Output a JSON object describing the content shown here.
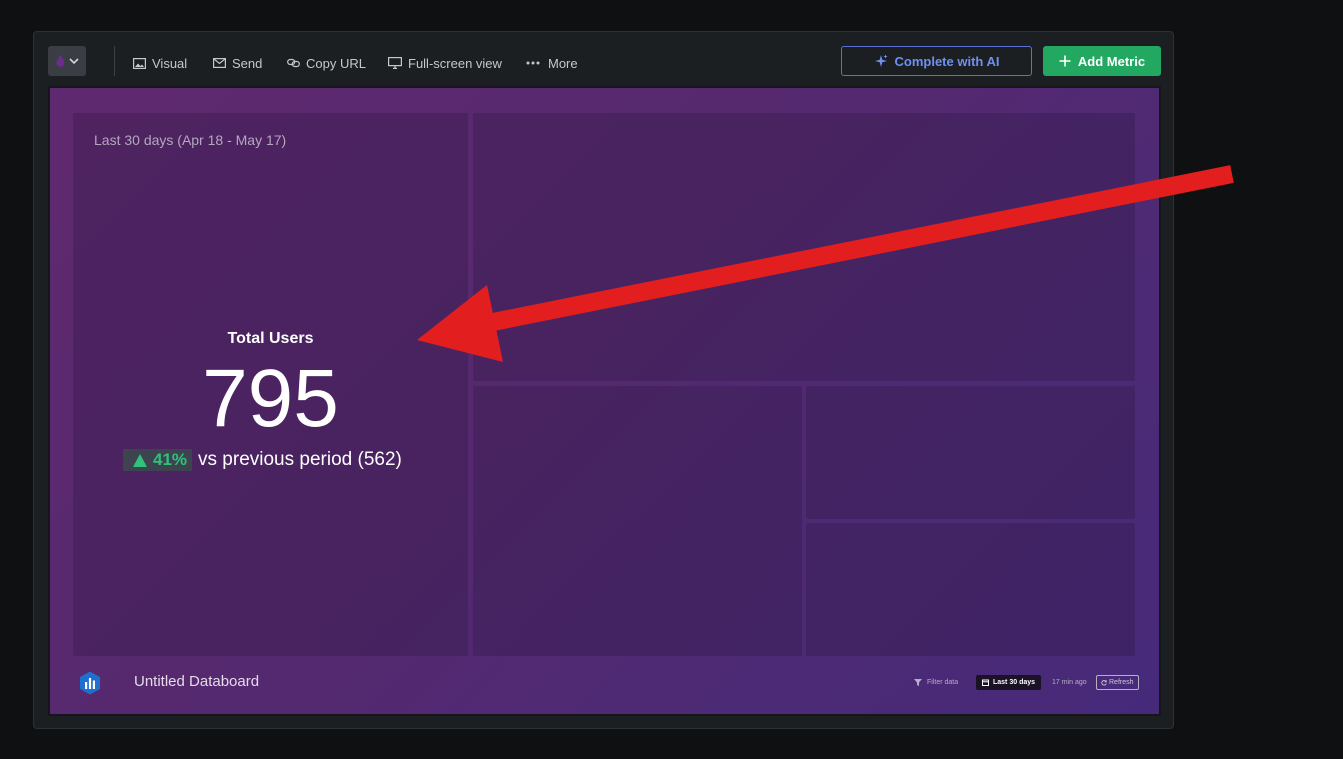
{
  "toolbar": {
    "theme_icon": "drop-icon",
    "visual_label": "Visual",
    "send_label": "Send",
    "copy_url_label": "Copy URL",
    "fullscreen_label": "Full-screen view",
    "more_label": "More",
    "ai_label": "Complete with AI",
    "add_metric_label": "Add Metric"
  },
  "metric": {
    "period": "Last 30 days (Apr 18 - May 17)",
    "title": "Total Users",
    "value": "795",
    "change": "41%",
    "change_direction": "up",
    "comparison": "vs previous period (562)"
  },
  "footer": {
    "board_name": "Untitled Databoard",
    "filter_label": "Filter data",
    "range_label": "Last 30 days",
    "updated_label": "17 min ago",
    "refresh_label": "Refresh"
  },
  "colors": {
    "accent_green": "#23a862",
    "ai_blue": "#6f8ff2",
    "annotation_red": "#e31e1e",
    "board_purple": "#5f296f"
  },
  "annotation": {
    "type": "arrow",
    "color": "#e31e1e",
    "points_to": "metric-title"
  }
}
